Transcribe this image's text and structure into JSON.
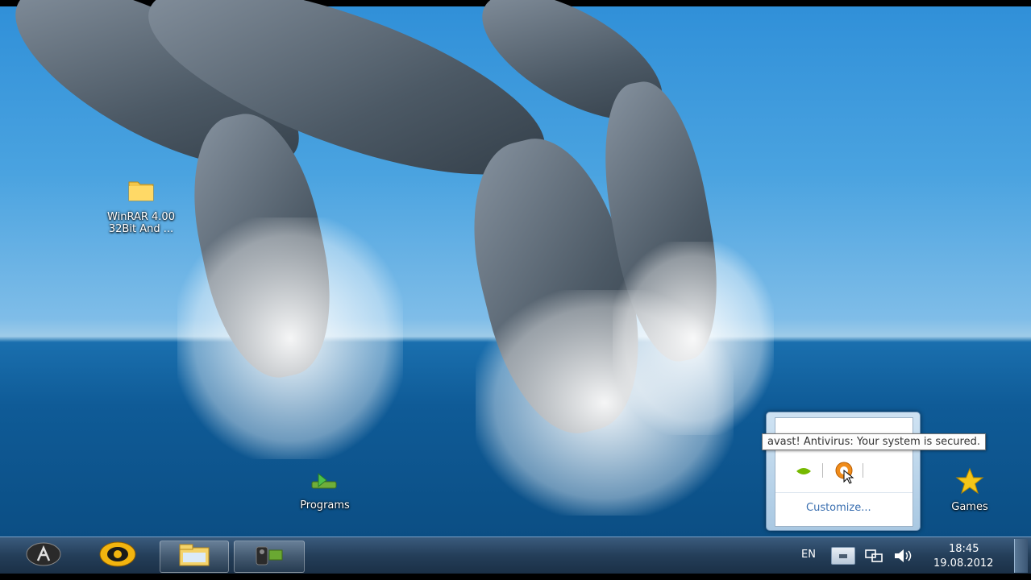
{
  "desktop": {
    "icons": [
      {
        "label_line1": "WinRAR 4.00",
        "label_line2": "32Bit And ...",
        "icon": "folder-icon"
      },
      {
        "label": "Programs",
        "icon": "programs-icon"
      },
      {
        "label": "Games",
        "icon": "star-icon"
      }
    ]
  },
  "tray_popup": {
    "tooltip": "avast! Antivirus: Your system is secured.",
    "customize_label": "Customize..."
  },
  "taskbar": {
    "language": "EN",
    "time": "18:45",
    "date": "19.08.2012",
    "buttons": [
      {
        "icon": "app-icon-dark"
      },
      {
        "icon": "app-icon-gold"
      },
      {
        "icon": "explorer-icon"
      },
      {
        "icon": "camera-app-icon"
      }
    ]
  },
  "colors": {
    "taskbar": "#243e59",
    "sky": "#4aa3e0",
    "sea": "#0f5b97",
    "link": "#3a6fb0"
  }
}
